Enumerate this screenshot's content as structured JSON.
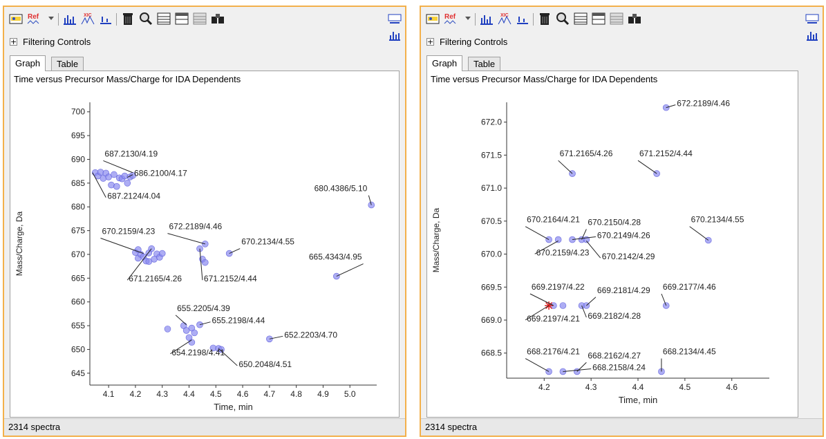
{
  "panels": [
    {
      "filtering_label": "Filtering Controls",
      "tabs": [
        "Graph",
        "Table"
      ],
      "status": "2314 spectra",
      "chart_data": {
        "type": "scatter",
        "title": "Time versus Precursor Mass/Charge for IDA Dependents",
        "xlabel": "Time, min",
        "ylabel": "Mass/Charge, Da",
        "xlim": [
          4.03,
          5.1
        ],
        "ylim": [
          642.5,
          702
        ],
        "xticks": [
          4.1,
          4.2,
          4.3,
          4.4,
          4.5,
          4.6,
          4.7,
          4.8,
          4.9,
          5.0
        ],
        "yticks": [
          645,
          650,
          655,
          660,
          665,
          670,
          675,
          680,
          685,
          690,
          695,
          700
        ],
        "points": [
          {
            "x": 4.05,
            "y": 687.2
          },
          {
            "x": 4.06,
            "y": 686.5
          },
          {
            "x": 4.07,
            "y": 687.3
          },
          {
            "x": 4.08,
            "y": 686.0
          },
          {
            "x": 4.09,
            "y": 687.1
          },
          {
            "x": 4.1,
            "y": 686.3
          },
          {
            "x": 4.11,
            "y": 684.6
          },
          {
            "x": 4.12,
            "y": 686.8
          },
          {
            "x": 4.13,
            "y": 684.3
          },
          {
            "x": 4.14,
            "y": 686.1
          },
          {
            "x": 4.15,
            "y": 685.9
          },
          {
            "x": 4.16,
            "y": 686.5
          },
          {
            "x": 4.17,
            "y": 685.0
          },
          {
            "x": 4.18,
            "y": 686.3
          },
          {
            "x": 4.19,
            "y": 686.6
          },
          {
            "x": 4.2,
            "y": 670.4
          },
          {
            "x": 4.21,
            "y": 669.2
          },
          {
            "x": 4.22,
            "y": 670.0
          },
          {
            "x": 4.23,
            "y": 669.5
          },
          {
            "x": 4.24,
            "y": 668.6
          },
          {
            "x": 4.25,
            "y": 670.3
          },
          {
            "x": 4.26,
            "y": 671.2
          },
          {
            "x": 4.27,
            "y": 669.0
          },
          {
            "x": 4.28,
            "y": 670.1
          },
          {
            "x": 4.29,
            "y": 669.4
          },
          {
            "x": 4.3,
            "y": 670.2
          },
          {
            "x": 4.21,
            "y": 671.0
          },
          {
            "x": 4.25,
            "y": 668.5
          },
          {
            "x": 4.44,
            "y": 671.2
          },
          {
            "x": 4.45,
            "y": 669.0
          },
          {
            "x": 4.46,
            "y": 672.2
          },
          {
            "x": 4.46,
            "y": 668.3
          },
          {
            "x": 4.55,
            "y": 670.2
          },
          {
            "x": 4.32,
            "y": 654.3
          },
          {
            "x": 4.38,
            "y": 655.0
          },
          {
            "x": 4.39,
            "y": 654.0
          },
          {
            "x": 4.4,
            "y": 652.5
          },
          {
            "x": 4.41,
            "y": 654.5
          },
          {
            "x": 4.42,
            "y": 653.5
          },
          {
            "x": 4.44,
            "y": 655.2
          },
          {
            "x": 4.41,
            "y": 651.5
          },
          {
            "x": 4.49,
            "y": 650.3
          },
          {
            "x": 4.51,
            "y": 650.2
          },
          {
            "x": 4.52,
            "y": 650.0
          },
          {
            "x": 4.7,
            "y": 652.2
          },
          {
            "x": 4.95,
            "y": 665.4
          },
          {
            "x": 5.08,
            "y": 680.4
          }
        ],
        "annotations": [
          {
            "text": "687.2130/4.19",
            "x": 4.19,
            "y": 687.2,
            "tx": 4.08,
            "ty": 690.3,
            "anchor": "start"
          },
          {
            "text": "686.2100/4.17",
            "x": 4.17,
            "y": 686.2,
            "tx": 4.19,
            "ty": 686.2,
            "anchor": "start"
          },
          {
            "text": "687.2124/4.04",
            "x": 4.04,
            "y": 687.2,
            "tx": 4.09,
            "ty": 681.4,
            "anchor": "start"
          },
          {
            "text": "670.2159/4.23",
            "x": 4.23,
            "y": 670.2,
            "tx": 4.07,
            "ty": 674.0,
            "anchor": "start"
          },
          {
            "text": "672.2189/4.46",
            "x": 4.46,
            "y": 672.2,
            "tx": 4.32,
            "ty": 675.0,
            "anchor": "start"
          },
          {
            "text": "670.2134/4.55",
            "x": 4.55,
            "y": 670.2,
            "tx": 4.59,
            "ty": 671.8,
            "anchor": "start"
          },
          {
            "text": "665.4343/4.95",
            "x": 4.95,
            "y": 665.4,
            "tx": 5.05,
            "ty": 668.6,
            "anchor": "end"
          },
          {
            "text": "680.4386/5.10",
            "x": 5.08,
            "y": 680.4,
            "tx": 5.07,
            "ty": 683.0,
            "anchor": "end"
          },
          {
            "text": "671.2165/4.26",
            "x": 4.26,
            "y": 671.2,
            "tx": 4.17,
            "ty": 664.0,
            "anchor": "start"
          },
          {
            "text": "671.2152/4.44",
            "x": 4.44,
            "y": 671.2,
            "tx": 4.45,
            "ty": 664.0,
            "anchor": "start"
          },
          {
            "text": "655.2205/4.39",
            "x": 4.39,
            "y": 655.2,
            "tx": 4.35,
            "ty": 657.8,
            "anchor": "start"
          },
          {
            "text": "655.2198/4.44",
            "x": 4.44,
            "y": 655.2,
            "tx": 4.48,
            "ty": 655.2,
            "anchor": "start"
          },
          {
            "text": "652.2203/4.70",
            "x": 4.7,
            "y": 652.2,
            "tx": 4.75,
            "ty": 652.2,
            "anchor": "start"
          },
          {
            "text": "654.2198/4.41",
            "x": 4.41,
            "y": 652.0,
            "tx": 4.33,
            "ty": 648.5,
            "anchor": "start"
          },
          {
            "text": "650.2048/4.51",
            "x": 4.51,
            "y": 650.2,
            "tx": 4.58,
            "ty": 646.0,
            "anchor": "start"
          }
        ]
      }
    },
    {
      "filtering_label": "Filtering Controls",
      "tabs": [
        "Graph",
        "Table"
      ],
      "status": "2314 spectra",
      "chart_data": {
        "type": "scatter",
        "title": "Time versus Precursor Mass/Charge for IDA Dependents",
        "xlabel": "Time, min",
        "ylabel": "Mass/Charge, Da",
        "xlim": [
          4.12,
          4.68
        ],
        "ylim": [
          668.12,
          672.3
        ],
        "xticks": [
          4.2,
          4.3,
          4.4,
          4.5,
          4.6
        ],
        "yticks": [
          668.5,
          669.0,
          669.5,
          670.0,
          670.5,
          671.0,
          671.5,
          672.0
        ],
        "points": [
          {
            "x": 4.46,
            "y": 672.22
          },
          {
            "x": 4.26,
            "y": 671.22
          },
          {
            "x": 4.44,
            "y": 671.22
          },
          {
            "x": 4.21,
            "y": 670.22
          },
          {
            "x": 4.23,
            "y": 670.22
          },
          {
            "x": 4.26,
            "y": 670.22
          },
          {
            "x": 4.28,
            "y": 670.22
          },
          {
            "x": 4.29,
            "y": 670.22
          },
          {
            "x": 4.55,
            "y": 670.21
          },
          {
            "x": 4.22,
            "y": 669.22
          },
          {
            "x": 4.24,
            "y": 669.22
          },
          {
            "x": 4.28,
            "y": 669.22
          },
          {
            "x": 4.29,
            "y": 669.22
          },
          {
            "x": 4.46,
            "y": 669.22
          },
          {
            "x": 4.21,
            "y": 668.22
          },
          {
            "x": 4.24,
            "y": 668.22
          },
          {
            "x": 4.27,
            "y": 668.22
          },
          {
            "x": 4.45,
            "y": 668.22
          }
        ],
        "highlight": {
          "x": 4.21,
          "y": 669.22,
          "color": "#e02020"
        },
        "annotations": [
          {
            "text": "672.2189/4.46",
            "x": 4.46,
            "y": 672.22,
            "tx": 4.48,
            "ty": 672.22,
            "anchor": "start"
          },
          {
            "text": "671.2165/4.26",
            "x": 4.26,
            "y": 671.22,
            "tx": 4.23,
            "ty": 671.46,
            "anchor": "start"
          },
          {
            "text": "671.2152/4.44",
            "x": 4.44,
            "y": 671.22,
            "tx": 4.4,
            "ty": 671.46,
            "anchor": "start"
          },
          {
            "text": "670.2164/4.21",
            "x": 4.21,
            "y": 670.22,
            "tx": 4.16,
            "ty": 670.46,
            "anchor": "start"
          },
          {
            "text": "670.2159/4.23",
            "x": 4.23,
            "y": 670.2,
            "tx": 4.18,
            "ty": 669.96,
            "anchor": "start"
          },
          {
            "text": "670.2150/4.28",
            "x": 4.28,
            "y": 670.22,
            "tx": 4.29,
            "ty": 670.42,
            "anchor": "start"
          },
          {
            "text": "670.2149/4.26",
            "x": 4.26,
            "y": 670.22,
            "tx": 4.31,
            "ty": 670.22,
            "anchor": "start"
          },
          {
            "text": "670.2142/4.29",
            "x": 4.29,
            "y": 670.2,
            "tx": 4.32,
            "ty": 669.9,
            "anchor": "start"
          },
          {
            "text": "670.2134/4.55",
            "x": 4.55,
            "y": 670.21,
            "tx": 4.51,
            "ty": 670.46,
            "anchor": "start"
          },
          {
            "text": "669.2197/4.22",
            "x": 4.22,
            "y": 669.22,
            "tx": 4.17,
            "ty": 669.44,
            "anchor": "start"
          },
          {
            "text": "669.2181/4.29",
            "x": 4.29,
            "y": 669.22,
            "tx": 4.31,
            "ty": 669.39,
            "anchor": "start"
          },
          {
            "text": "669.2177/4.46",
            "x": 4.46,
            "y": 669.22,
            "tx": 4.45,
            "ty": 669.44,
            "anchor": "start"
          },
          {
            "text": "669.2197/4.21",
            "x": 4.21,
            "y": 669.22,
            "tx": 4.16,
            "ty": 668.96,
            "anchor": "start"
          },
          {
            "text": "669.2182/4.28",
            "x": 4.28,
            "y": 669.22,
            "tx": 4.29,
            "ty": 669.0,
            "anchor": "start"
          },
          {
            "text": "668.2176/4.21",
            "x": 4.21,
            "y": 668.22,
            "tx": 4.16,
            "ty": 668.46,
            "anchor": "start"
          },
          {
            "text": "668.2162/4.27",
            "x": 4.27,
            "y": 668.22,
            "tx": 4.29,
            "ty": 668.4,
            "anchor": "start"
          },
          {
            "text": "668.2158/4.24",
            "x": 4.24,
            "y": 668.22,
            "tx": 4.3,
            "ty": 668.22,
            "anchor": "start"
          },
          {
            "text": "668.2134/4.45",
            "x": 4.45,
            "y": 668.22,
            "tx": 4.45,
            "ty": 668.46,
            "anchor": "start"
          }
        ]
      }
    }
  ],
  "toolbar": {
    "icons": [
      "open-graph-icon",
      "ref-icon",
      "dropdown-arrow-icon",
      "spectrum-bar-icon",
      "xic-icon",
      "baseline-icon",
      "delete-icon",
      "zoom-icon",
      "layout-one-icon",
      "layout-two-icon",
      "layout-three-icon",
      "overlay-icon"
    ],
    "ref_label": "Ref",
    "xic_label": "XIC"
  },
  "colors": {
    "point": "#8a8af0",
    "point_stroke": "#6666dd",
    "frame": "#f3b04a",
    "highlight": "#e02020"
  }
}
